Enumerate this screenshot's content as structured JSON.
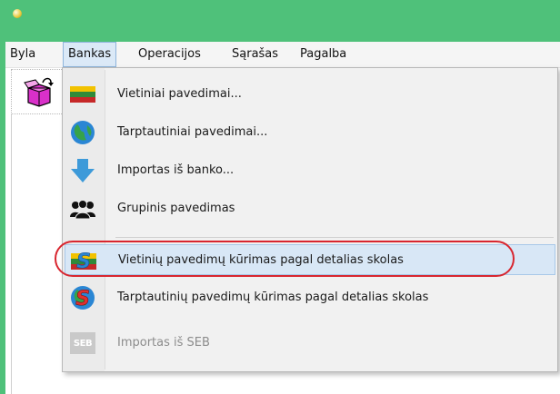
{
  "menubar": {
    "items": [
      "Byla",
      "Bankas",
      "Operacijos",
      "Sąrašas",
      "Pagalba"
    ]
  },
  "dropdown": {
    "items": [
      {
        "label": "Vietiniai pavedimai...",
        "icon": "lithuania-flag-icon"
      },
      {
        "label": "Tarptautiniai pavedimai...",
        "icon": "globe-icon"
      },
      {
        "label": "Importas iš banko...",
        "icon": "down-arrow-icon"
      },
      {
        "label": "Grupinis pavedimas",
        "icon": "group-people-icon"
      },
      {
        "label": "Vietinių pavedimų kūrimas pagal detalias skolas",
        "icon": "flag-dollar-icon"
      },
      {
        "label": "Tarptautinių pavedimų kūrimas pagal detalias skolas",
        "icon": "globe-dollar-icon"
      },
      {
        "label": "Importas iš SEB",
        "icon": "seb-icon",
        "icon_text": "SEB"
      }
    ]
  },
  "colors": {
    "titlebar": "#4fc17a",
    "highlight": "#d8e7f6",
    "annotation": "#d8262f"
  }
}
